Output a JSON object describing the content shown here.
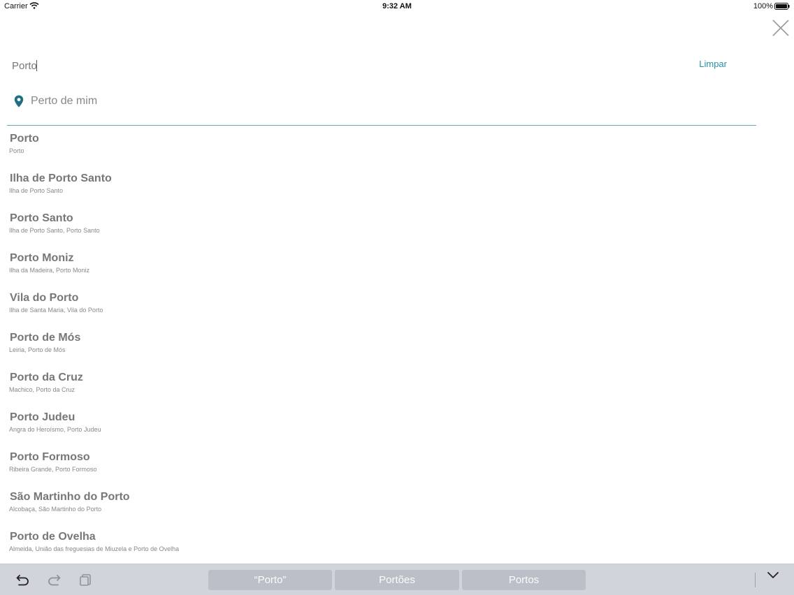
{
  "status_bar": {
    "carrier": "Carrier",
    "time": "9:32 AM",
    "battery": "100%"
  },
  "search": {
    "value": "Porto",
    "clear_label": "Limpar"
  },
  "near_me": {
    "label": "Perto de mim"
  },
  "accent_color": "#2a8fa6",
  "results": [
    {
      "title": "Porto",
      "subtitle": "Porto"
    },
    {
      "title": "Ilha de Porto Santo",
      "subtitle": "Ilha de Porto Santo"
    },
    {
      "title": "Porto Santo",
      "subtitle": "Ilha de Porto Santo, Porto Santo"
    },
    {
      "title": "Porto Moniz",
      "subtitle": "Ilha da Madeira, Porto Moniz"
    },
    {
      "title": "Vila do Porto",
      "subtitle": "Ilha de Santa Maria, Vila do Porto"
    },
    {
      "title": "Porto de Mós",
      "subtitle": "Leiria, Porto de Mós"
    },
    {
      "title": "Porto da Cruz",
      "subtitle": "Machico, Porto da Cruz"
    },
    {
      "title": "Porto Judeu",
      "subtitle": "Angra do Heroísmo, Porto Judeu"
    },
    {
      "title": "Porto Formoso",
      "subtitle": "Ribeira Grande, Porto Formoso"
    },
    {
      "title": "São Martinho do Porto",
      "subtitle": "Alcobaça, São Martinho do Porto"
    },
    {
      "title": "Porto de Ovelha",
      "subtitle": "Almeida, União das freguesias de Miuzela e Porto de Ovelha"
    }
  ],
  "keyboard_bar": {
    "suggestions": [
      "“Porto”",
      "Portões",
      "Portos"
    ],
    "icons": [
      "undo-icon",
      "redo-icon",
      "paste-icon",
      "chevron-down-icon"
    ]
  }
}
